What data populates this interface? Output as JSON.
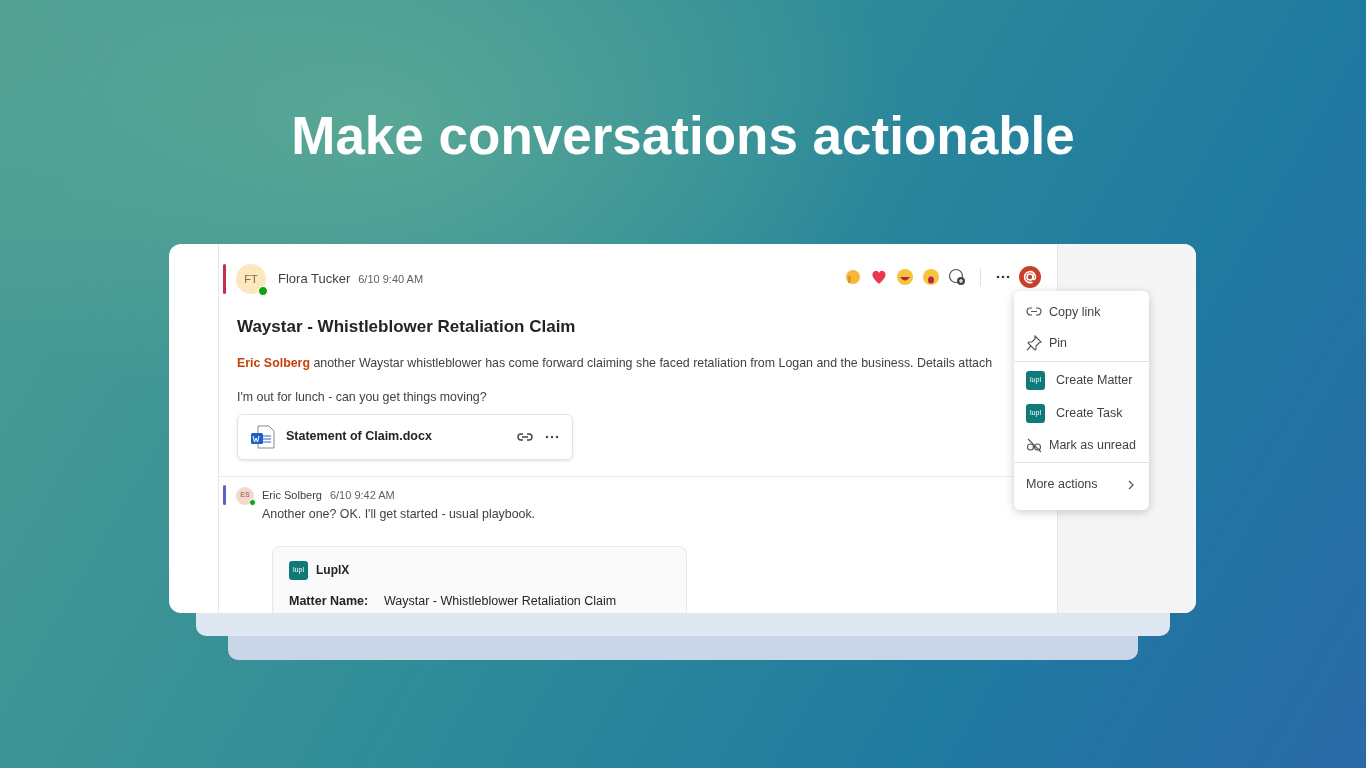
{
  "headline": "Make conversations actionable",
  "message": {
    "initials": "FT",
    "author": "Flora Tucker",
    "online": true,
    "time": "6/10 9:40 AM",
    "subject": "Waystar - Whistleblower Retaliation Claim",
    "mention": "Eric Solberg",
    "body": "another Waystar whistleblower has come forward claiming she faced retaliation from Logan and the business. Details attach",
    "body_2": "I'm out for lunch - can you get things moving?",
    "attachment": {
      "name": "Statement of Claim.docx"
    }
  },
  "reply": {
    "initials": "ES",
    "author": "Eric Solberg",
    "online": true,
    "time": "6/10 9:42 AM",
    "body": "Another one? OK. I'll get started - usual playbook.",
    "card": {
      "app_icon": "lupl",
      "app_name": "LuplX",
      "fields": [
        {
          "label": "Matter Name:",
          "value": "Waystar - Whistleblower Retaliation Claim"
        }
      ]
    }
  },
  "menu": {
    "groups": [
      {
        "items": [
          {
            "kind": "link",
            "label": "Copy link"
          },
          {
            "kind": "pin",
            "label": "Pin"
          }
        ]
      },
      {
        "items": [
          {
            "kind": "app",
            "icon_text": "lupl",
            "label": "Create Matter"
          },
          {
            "kind": "app",
            "icon_text": "lupl",
            "label": "Create Task"
          },
          {
            "kind": "unread",
            "label": "Mark as unread"
          }
        ]
      },
      {
        "items": [
          {
            "kind": "more",
            "label": "More actions"
          }
        ]
      }
    ]
  }
}
